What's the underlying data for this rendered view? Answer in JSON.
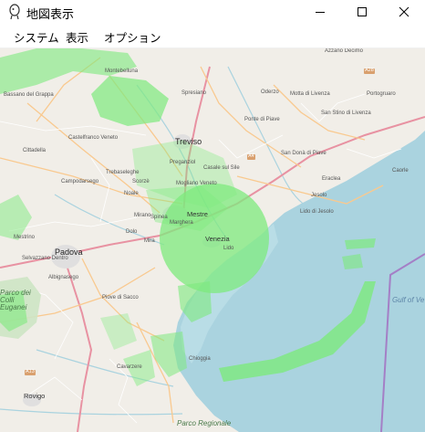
{
  "window": {
    "title": "地図表示",
    "app_icon": "app-logo-icon",
    "controls": {
      "minimize": "minimize-icon",
      "maximize": "maximize-icon",
      "close": "close-icon"
    }
  },
  "menu": {
    "items": [
      "システム",
      "表示",
      "オプション"
    ]
  },
  "map": {
    "colors": {
      "land": "#f1eee8",
      "sea": "#aad3df",
      "coverage": "#7dea7d",
      "boundary": "#a47fc6"
    },
    "labels": {
      "bassano": "Bassano del Grappa",
      "montebelluna": "Montebelluna",
      "spresiano": "Spresiano",
      "oderzo": "Oderzo",
      "motta": "Motta di Livenza",
      "portogruaro": "Portogruaro",
      "azzano": "Azzano Decimo",
      "castelfranco": "Castelfranco Veneto",
      "treviso": "Treviso",
      "ponte_piave": "Ponte di Piave",
      "sandona": "San Donà di Piave",
      "sanstino": "San Stino di Livenza",
      "cittadella": "Cittadella",
      "trebaseleghe": "Trebaseleghe",
      "campodarsego": "Campodarsego",
      "scorze": "Scorzè",
      "preganziol": "Preganziol",
      "casale": "Casale sul Sile",
      "mogliano": "Mogliano Veneto",
      "eraclea": "Eraclea",
      "caorle": "Caorle",
      "jesolo": "Jesolo",
      "lido_jesolo": "Lido di Jesolo",
      "noale": "Noale",
      "mirano": "Mirano",
      "spinea": "Spinea",
      "mestre": "Mestre",
      "marghera": "Marghera",
      "venezia": "Venezia",
      "lido": "Lido",
      "dolo": "Dolo",
      "mira": "Mira",
      "mestrino": "Mestrino",
      "padova": "Padova",
      "selvazzano": "Selvazzano Dentro",
      "albignasego": "Albignasego",
      "piove": "Piove di Sacco",
      "chioggia": "Chioggia",
      "cavarzere": "Cavarzere",
      "euganei": "Parco dei Colli Euganei",
      "rovigo": "Rovigo",
      "parco_regionale": "Parco Regionale",
      "gulf": "Gulf of Ve",
      "a28": "A28",
      "a4": "A4",
      "a13": "A13"
    }
  }
}
